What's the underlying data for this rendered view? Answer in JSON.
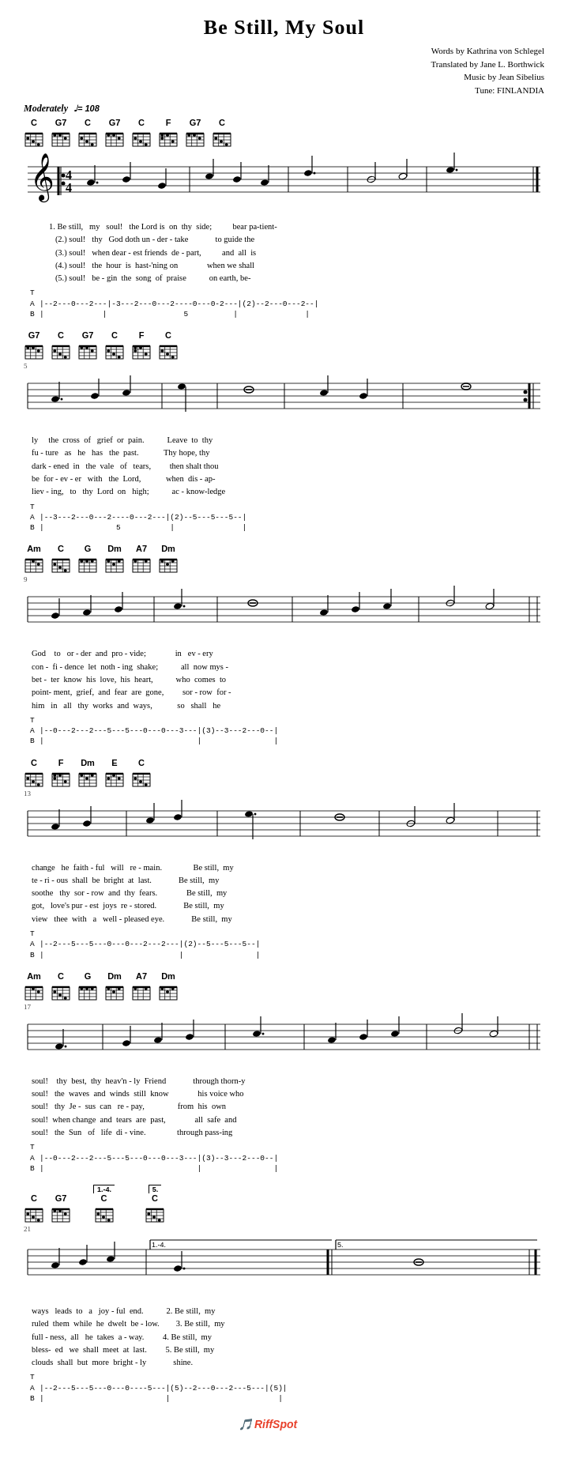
{
  "title": "Be Still, My Soul",
  "credits": {
    "line1": "Words by Kathrina von Schlegel",
    "line2": "Translated by Jane L. Borthwick",
    "line3": "Music by Jean Sibelius",
    "line4": "Tune: FINLANDIA"
  },
  "tempo": {
    "label": "Moderately",
    "bpm": "♩= 108"
  },
  "watermark": "RiffSpot",
  "sections": [
    {
      "id": "section1",
      "measure_start": 1,
      "chords": [
        "C",
        "G7",
        "C",
        "G7",
        "C",
        "F",
        "G7",
        "C"
      ],
      "lyrics": [
        "1. Be still,   my    soul!   the Lord is  on  thy  side;        bear  pa-tient-",
        "(2.) soul!    thy   God  doth un - der - take            to  guide the",
        "(3.) soul!   when dear - est friends  de - part,         and  all  is",
        "(4.) soul!   the  hour  is  hast-'ning on              when we shall",
        "(5.) soul!    be - gin  the  song  of  praise           on earth, be-"
      ],
      "tab": [
        "A|--2---0---2---|-3---2---0---2----0---0-2---|(2)--2---0---2--|",
        "E|               |                5           |               |"
      ]
    },
    {
      "id": "section2",
      "measure_start": 5,
      "chords": [
        "G7",
        "C",
        "G7",
        "C",
        "F",
        "C"
      ],
      "lyrics": [
        "ly    the  cross  of   grief  or  pain.         Leave  to  thy",
        "fu -  ture  as   he   has   the  past.          Thy hope, thy",
        "dark- ened  in   the  vale   of   tears,        then  shalt thou",
        "be  for - ev -  er   with   the  Lord,          when  dis - ap-",
        "liev - ing,  to   thy  Lord  on   high;          ac - know - ledge"
      ],
      "tab": [
        "A|--3---2---0---2----0---2---|(2)--5---5---5--|",
        "E|               5           |                |"
      ]
    },
    {
      "id": "section3",
      "measure_start": 9,
      "chords": [
        "Am",
        "C",
        "G",
        "Dm",
        "A7",
        "Dm"
      ],
      "lyrics": [
        "God    to   or - der  and  pro - vide;          in   ev - ery",
        "con -  fi - dence  let  noth - ing  shake;       all  now mys -",
        "bet -  ter  know  his  love,  his  heart,        who  comes  to",
        "point- ment,  grief,  and  fear  are  gone,      sor - row  for -",
        "him   in   all   thy  works  and  ways,          so   shall  he"
      ],
      "tab": [
        "A|--0---2---2---5---5---0---0---3---|(3)--3---2---0--|",
        "E|                                  |                |"
      ]
    },
    {
      "id": "section4",
      "measure_start": 13,
      "chords": [
        "C",
        "F",
        "Dm",
        "E",
        "C"
      ],
      "lyrics": [
        "change   he  faith - ful   will   re - main.          Be still,  my",
        "te - ri - ous  shall  be  bright  at  last.           Be still,  my",
        "soothe  thy  sor - row  and  thy  fears.              Be still,  my",
        "got,   love's pur - est  joys  re - stored.           Be still,  my",
        "view   thee  with  a   well - pleased eye.            Be still,  my"
      ],
      "tab": [
        "A|--2---5---5---0---0---2---2---|(2)--5---5---5--|",
        "E|                              |                |"
      ]
    },
    {
      "id": "section5",
      "measure_start": 17,
      "chords": [
        "Am",
        "C",
        "G",
        "Dm",
        "A7",
        "Dm"
      ],
      "lyrics": [
        "soul!   thy  best,  thy  heav'n - ly  Friend          through thorn-y",
        "soul!   the  waves  and  winds  still  know            his voice who",
        "soul!   thy  Je -  sus  can   re - pay,               from  his  own",
        "soul!  when change  and  tears  are  past,             all  safe  and",
        "soul!  the  Sun   of   life  di - vine.               through pass-ing"
      ],
      "tab": [
        "A|--0---2---2---5---5---0---0---3---|(3)--3---2---0--|",
        "E|                                  |                |"
      ]
    },
    {
      "id": "section6",
      "measure_start": 21,
      "chords_left": [
        "C",
        "G7"
      ],
      "chords_right1": [
        "1.-4. C"
      ],
      "chords_right2": [
        "5. C"
      ],
      "lyrics": [
        "ways   leads  to   a   joy - ful  end.          2. Be still,  my",
        "ruled  them  while  he  dwelt  be - low.        3. Be still,  my",
        "full - ness,  all  he  takes  a - way.          4. Be still,  my",
        "bless- ed   we  shall  meet  at  last.          5. Be still,  my",
        "clouds  shall  but  more  bright - ly            shine."
      ],
      "tab": [
        "A|--2---5---5---0---0----5---|(5)--2---0---2---5---|(5)|",
        "E|                           |                        |"
      ]
    }
  ]
}
